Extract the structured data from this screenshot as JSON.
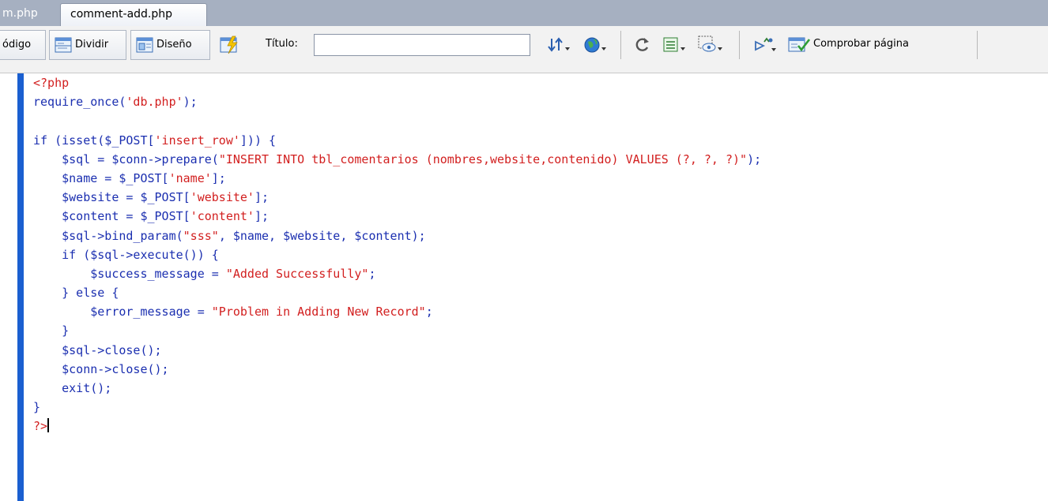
{
  "tabs": [
    {
      "label": "m.php",
      "active": false
    },
    {
      "label": "comment-add.php",
      "active": true
    }
  ],
  "toolbar": {
    "code_label": "ódigo",
    "split_label": "Dividir",
    "design_label": "Diseño",
    "title_label": "Título:",
    "title_value": "",
    "check_page_label": "Comprobar página"
  },
  "icons": {
    "split": "split-view-icon",
    "design": "design-view-icon",
    "live": "live-view-icon",
    "transfer": "file-transfer-icon",
    "browser": "browser-preview-icon",
    "refresh": "refresh-icon",
    "view_options": "view-options-icon",
    "visual_aids": "visual-aids-icon",
    "validate": "validate-markup-icon",
    "check_page": "check-page-icon"
  },
  "editor": {
    "gutter_color": "#1a5fd0",
    "lines": [
      "<?php",
      "require_once('db.php');",
      "",
      "if (isset($_POST['insert_row'])) {",
      "    $sql = $conn->prepare(\"INSERT INTO tbl_comentarios (nombres,website,contenido) VALUES (?, ?, ?)\");",
      "    $name = $_POST['name'];",
      "    $website = $_POST['website'];",
      "    $content = $_POST['content'];",
      "    $sql->bind_param(\"sss\", $name, $website, $content);",
      "    if ($sql->execute()) {",
      "        $success_message = \"Added Successfully\";",
      "    } else {",
      "        $error_message = \"Problem in Adding New Record\";",
      "    }",
      "    $sql->close();",
      "    $conn->close();",
      "    exit();",
      "}",
      "?>"
    ]
  }
}
